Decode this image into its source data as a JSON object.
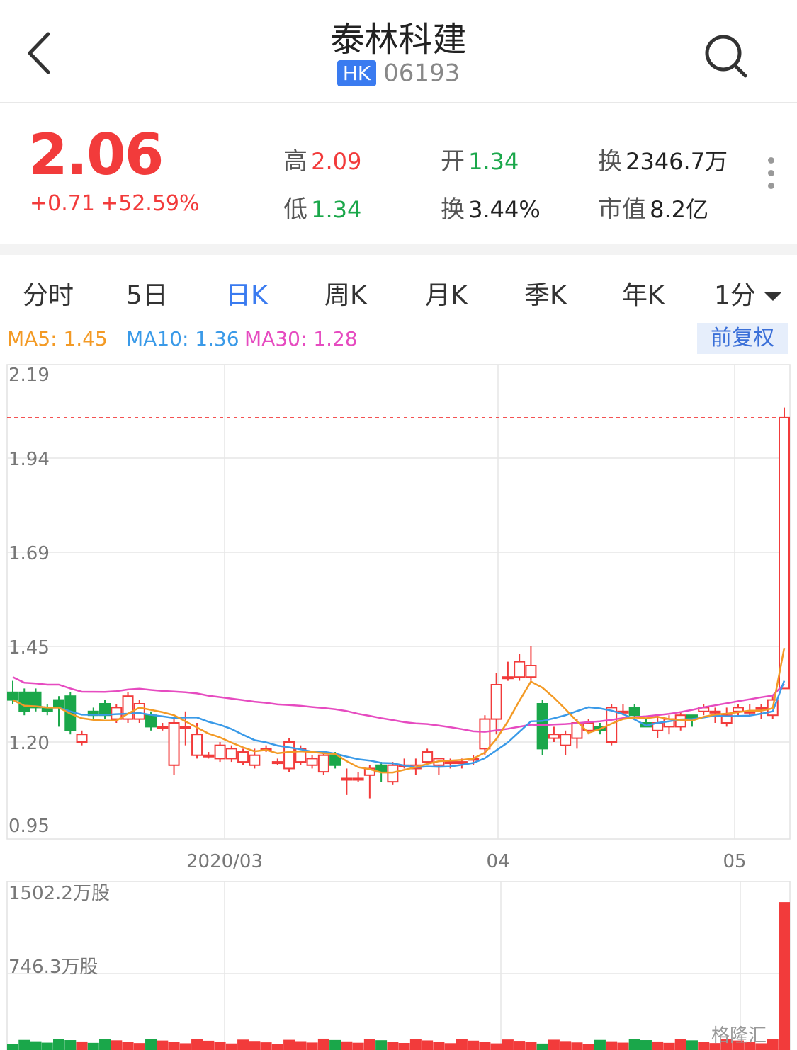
{
  "header": {
    "title": "泰林科建",
    "market": "HK",
    "code": "06193"
  },
  "quote": {
    "price": "2.06",
    "change": "+0.71",
    "change_pct": "+52.59%",
    "high_label": "高",
    "high": "2.09",
    "low_label": "低",
    "low": "1.34",
    "open_label": "开",
    "open": "1.34",
    "turnover_rate_label": "换",
    "turnover_rate": "3.44%",
    "turnover_label": "换",
    "turnover": "2346.7万",
    "mktcap_label": "市值",
    "mktcap": "8.2亿"
  },
  "tabs": [
    {
      "label": "分时"
    },
    {
      "label": "5日"
    },
    {
      "label": "日K",
      "active": true
    },
    {
      "label": "周K"
    },
    {
      "label": "月K"
    },
    {
      "label": "季K"
    },
    {
      "label": "年K"
    },
    {
      "label": "1分"
    }
  ],
  "indicators": {
    "ma5": "MA5: 1.45",
    "ma10": "MA10: 1.36",
    "ma30": "MA30: 1.28",
    "adjust_button": "前复权"
  },
  "colors": {
    "up": "#f23b3b",
    "down": "#1aa74a",
    "accent": "#3a7bf0",
    "ma5": "#f39a25",
    "ma10": "#3a9ae8",
    "ma30": "#e64bc0"
  },
  "icons": {
    "back": "chevron-left-icon",
    "search": "search-icon",
    "more": "more-vertical-icon",
    "dropdown": "caret-down-icon"
  },
  "chart_data": {
    "type": "candlestick",
    "y_ticks": [
      "2.19",
      "1.94",
      "1.69",
      "1.45",
      "1.20",
      "0.95"
    ],
    "ylim": [
      0.95,
      2.19
    ],
    "x_ticks": [
      "2020/03",
      "04",
      "05"
    ],
    "current_price_line": 2.06,
    "candles": [
      [
        1.33,
        1.31,
        1.36,
        1.3
      ],
      [
        1.33,
        1.28,
        1.34,
        1.27
      ],
      [
        1.33,
        1.29,
        1.34,
        1.28
      ],
      [
        1.29,
        1.28,
        1.3,
        1.27
      ],
      [
        1.31,
        1.29,
        1.32,
        1.24
      ],
      [
        1.32,
        1.23,
        1.33,
        1.22
      ],
      [
        1.2,
        1.22,
        1.23,
        1.19
      ],
      [
        1.28,
        1.27,
        1.29,
        1.26
      ],
      [
        1.3,
        1.27,
        1.31,
        1.26
      ],
      [
        1.26,
        1.29,
        1.3,
        1.25
      ],
      [
        1.26,
        1.32,
        1.33,
        1.25
      ],
      [
        1.26,
        1.3,
        1.31,
        1.25
      ],
      [
        1.27,
        1.24,
        1.28,
        1.23
      ],
      [
        1.24,
        1.24,
        1.25,
        1.23
      ],
      [
        1.13,
        1.25,
        1.26,
        1.1
      ],
      [
        1.24,
        1.24,
        1.28,
        1.19
      ],
      [
        1.16,
        1.22,
        1.25,
        1.15
      ],
      [
        1.16,
        1.16,
        1.17,
        1.15
      ],
      [
        1.15,
        1.19,
        1.2,
        1.14
      ],
      [
        1.15,
        1.18,
        1.19,
        1.14
      ],
      [
        1.14,
        1.17,
        1.18,
        1.13
      ],
      [
        1.13,
        1.16,
        1.18,
        1.12
      ],
      [
        1.18,
        1.18,
        1.19,
        1.17
      ],
      [
        1.14,
        1.14,
        1.15,
        1.13
      ],
      [
        1.12,
        1.2,
        1.21,
        1.11
      ],
      [
        1.14,
        1.18,
        1.19,
        1.13
      ],
      [
        1.13,
        1.15,
        1.16,
        1.12
      ],
      [
        1.11,
        1.16,
        1.17,
        1.1
      ],
      [
        1.16,
        1.13,
        1.17,
        1.12
      ],
      [
        1.09,
        1.09,
        1.12,
        1.04
      ],
      [
        1.09,
        1.09,
        1.11,
        1.08
      ],
      [
        1.1,
        1.12,
        1.13,
        1.03
      ],
      [
        1.13,
        1.11,
        1.14,
        1.08
      ],
      [
        1.08,
        1.13,
        1.14,
        1.07
      ],
      [
        1.13,
        1.13,
        1.15,
        1.12
      ],
      [
        1.12,
        1.13,
        1.15,
        1.1
      ],
      [
        1.14,
        1.17,
        1.18,
        1.13
      ],
      [
        1.13,
        1.15,
        1.15,
        1.1
      ],
      [
        1.14,
        1.14,
        1.15,
        1.12
      ],
      [
        1.14,
        1.14,
        1.15,
        1.12
      ],
      [
        1.15,
        1.15,
        1.16,
        1.13
      ],
      [
        1.18,
        1.26,
        1.27,
        1.16
      ],
      [
        1.26,
        1.35,
        1.38,
        1.22
      ],
      [
        1.37,
        1.37,
        1.41,
        1.36
      ],
      [
        1.37,
        1.41,
        1.43,
        1.36
      ],
      [
        1.37,
        1.4,
        1.45,
        1.36
      ],
      [
        1.3,
        1.18,
        1.31,
        1.16
      ],
      [
        1.21,
        1.22,
        1.24,
        1.2
      ],
      [
        1.19,
        1.22,
        1.23,
        1.16
      ],
      [
        1.21,
        1.25,
        1.26,
        1.18
      ],
      [
        1.23,
        1.25,
        1.26,
        1.22
      ],
      [
        1.24,
        1.23,
        1.25,
        1.22
      ],
      [
        1.2,
        1.29,
        1.3,
        1.19
      ],
      [
        1.28,
        1.28,
        1.3,
        1.27
      ],
      [
        1.29,
        1.27,
        1.3,
        1.26
      ],
      [
        1.25,
        1.24,
        1.26,
        1.24
      ],
      [
        1.23,
        1.25,
        1.27,
        1.21
      ],
      [
        1.24,
        1.26,
        1.27,
        1.22
      ],
      [
        1.24,
        1.27,
        1.28,
        1.23
      ],
      [
        1.27,
        1.26,
        1.27,
        1.24
      ],
      [
        1.28,
        1.29,
        1.3,
        1.27
      ],
      [
        1.28,
        1.28,
        1.29,
        1.25
      ],
      [
        1.25,
        1.27,
        1.29,
        1.24
      ],
      [
        1.28,
        1.29,
        1.3,
        1.27
      ],
      [
        1.28,
        1.28,
        1.3,
        1.27
      ],
      [
        1.29,
        1.29,
        1.3,
        1.26
      ],
      [
        1.27,
        1.31,
        1.32,
        1.26
      ],
      [
        1.34,
        2.06,
        2.09,
        1.34
      ]
    ],
    "ma5_value": 1.45,
    "ma10_value": 1.36,
    "ma30_value": 1.28,
    "volume": {
      "y_ticks": [
        "1502.2万股",
        "746.3万股"
      ],
      "max": 1502.2,
      "unit": "万股",
      "last_bar": 1420
    }
  }
}
